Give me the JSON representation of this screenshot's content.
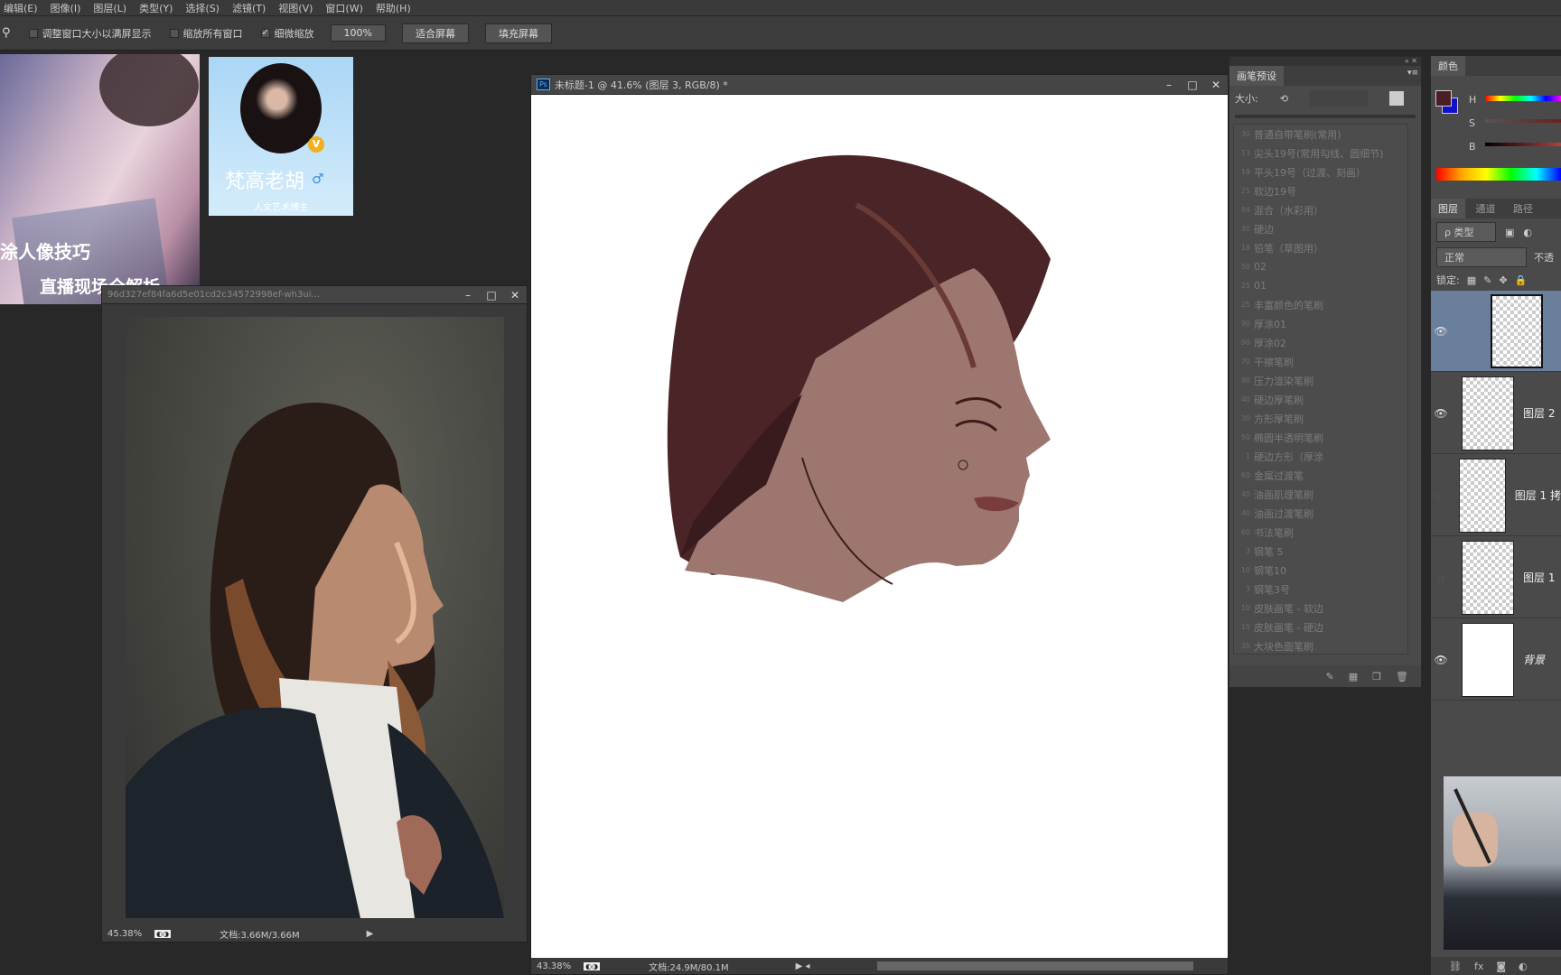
{
  "menu": [
    "编辑(E)",
    "图像(I)",
    "图层(L)",
    "类型(Y)",
    "选择(S)",
    "滤镜(T)",
    "视图(V)",
    "窗口(W)",
    "帮助(H)"
  ],
  "options": {
    "resize_windows": "调整窗口大小以满屏显示",
    "zoom_all": "缩放所有窗口",
    "scrubby_zoom": "细微缩放",
    "btn_100": "100%",
    "btn_fit": "适合屏幕",
    "btn_fill": "填充屏幕",
    "scrubby_checked": true
  },
  "promo": {
    "line1": "涂人像技巧",
    "line2": "直播现场全解析"
  },
  "profile": {
    "name": "梵高老胡",
    "subtitle": "人文艺术博主",
    "badge": "V"
  },
  "ref_doc": {
    "title": "96d327ef84fa6d5e01cd2c34572998ef-wh3ui...",
    "zoom": "45.38%",
    "doc_size": "文档:3.66M/3.66M"
  },
  "main_doc": {
    "app_badge": "Ps",
    "title": "未标题-1 @ 41.6% (图层 3, RGB/8) *",
    "zoom": "43.38%",
    "doc_size": "文档:24.9M/80.1M"
  },
  "brush_panel": {
    "tab": "画笔预设",
    "size_label": "大小:",
    "items": [
      [
        "30",
        "普通自带笔刷(常用)"
      ],
      [
        "13",
        "尖头19号(常用勾线、圆细节)"
      ],
      [
        "19",
        "平头19号（过渡、刻画）"
      ],
      [
        "25",
        "软边19号"
      ],
      [
        "84",
        "混合（水彩用）"
      ],
      [
        "30",
        "硬边"
      ],
      [
        "18",
        "铅笔（草图用）"
      ],
      [
        "50",
        "02"
      ],
      [
        "25",
        "01"
      ],
      [
        "25",
        "丰富颜色的笔刷"
      ],
      [
        "90",
        "厚涂01"
      ],
      [
        "90",
        "厚涂02"
      ],
      [
        "70",
        "干擦笔刷"
      ],
      [
        "90",
        "压力渲染笔刷"
      ],
      [
        "40",
        "硬边厚笔刷"
      ],
      [
        "30",
        "方形厚笔刷"
      ],
      [
        "50",
        "椭圆半透明笔刷"
      ],
      [
        "1",
        "硬边方形（厚涂"
      ],
      [
        "60",
        "金属过渡笔"
      ],
      [
        "40",
        "油画肌理笔刷"
      ],
      [
        "40",
        "油画过渡笔刷"
      ],
      [
        "60",
        "书法笔刷"
      ],
      [
        "3",
        "钢笔 5"
      ],
      [
        "10",
        "钢笔10"
      ],
      [
        "3",
        "钢笔3号"
      ],
      [
        "10",
        "皮肤画笔 - 软边"
      ],
      [
        "15",
        "皮肤画笔 - 硬边"
      ],
      [
        "35",
        "大块色面笔刷"
      ]
    ]
  },
  "color_panel": {
    "tab": "颜色",
    "h": "H",
    "s": "S",
    "b": "B",
    "foreground": "#4a1e24",
    "background": "#1010c8"
  },
  "layers_panel": {
    "tabs": [
      "图层",
      "通道",
      "路径"
    ],
    "filter": "ρ 类型",
    "blend": "正常",
    "opacity_label": "不透",
    "lock_label": "锁定:",
    "layers": [
      {
        "name": "",
        "visible": true,
        "selected": true
      },
      {
        "name": "图层 2",
        "visible": true
      },
      {
        "name": "图层 1 拷",
        "visible": false
      },
      {
        "name": "图层 1",
        "visible": false
      },
      {
        "name": "背景",
        "visible": true
      }
    ]
  }
}
